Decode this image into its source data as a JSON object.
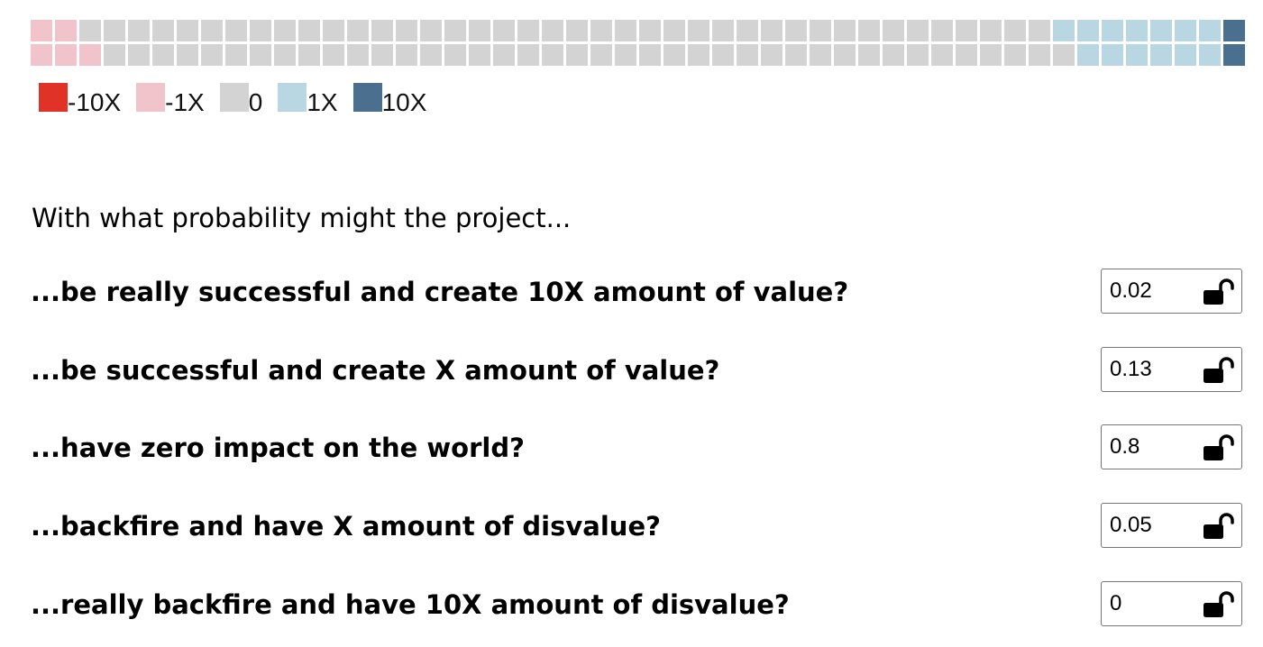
{
  "waffle": {
    "columns": 50,
    "rows": 2,
    "counts": {
      "neg10x": 0,
      "neg1x": 5,
      "zero": 80,
      "pos1x": 13,
      "pos10x": 2
    },
    "colors": {
      "neg10x": "#e03226",
      "neg1x": "#f1c3cb",
      "zero": "#d3d3d3",
      "pos1x": "#b8d7e3",
      "pos10x": "#4b6f8f"
    }
  },
  "legend": [
    {
      "key": "neg10x",
      "label": "-10X",
      "color": "#e03226"
    },
    {
      "key": "neg1x",
      "label": "-1X",
      "color": "#f1c3cb"
    },
    {
      "key": "zero",
      "label": "0",
      "color": "#d3d3d3"
    },
    {
      "key": "pos1x",
      "label": "1X",
      "color": "#b8d7e3"
    },
    {
      "key": "pos10x",
      "label": "10X",
      "color": "#4b6f8f"
    }
  ],
  "intro": "With what probability might the project...",
  "questions": [
    {
      "text": "...be really successful and create 10X amount of value?",
      "value": "0.02",
      "lock_icon": "unlocked-padlock-icon"
    },
    {
      "text": "...be successful and create X amount of value?",
      "value": "0.13",
      "lock_icon": "unlocked-padlock-icon"
    },
    {
      "text": "...have zero impact on the world?",
      "value": "0.8",
      "lock_icon": "unlocked-padlock-icon"
    },
    {
      "text": "...backfire and have X amount of disvalue?",
      "value": "0.05",
      "lock_icon": "unlocked-padlock-icon"
    },
    {
      "text": "...really backfire and have 10X amount of disvalue?",
      "value": "0",
      "lock_icon": "unlocked-padlock-icon"
    }
  ]
}
